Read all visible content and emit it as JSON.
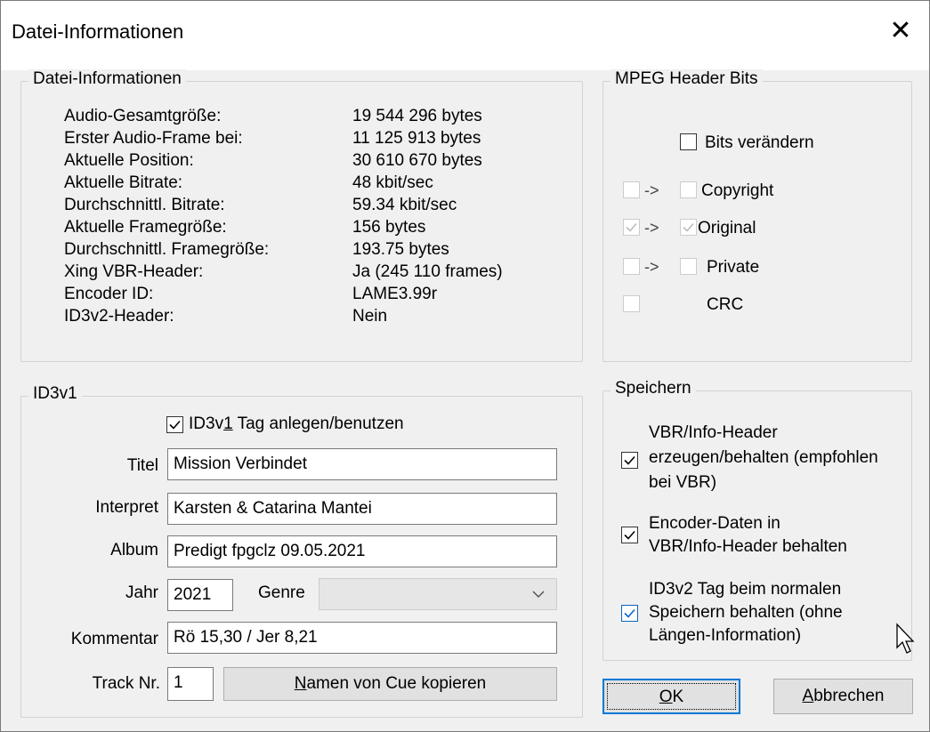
{
  "window": {
    "title": "Datei-Informationen",
    "close_glyph": "✕"
  },
  "file_info": {
    "legend": "Datei-Informationen",
    "rows": [
      {
        "label": "Audio-Gesamtgröße:",
        "value": "19 544 296 bytes"
      },
      {
        "label": "Erster Audio-Frame bei:",
        "value": "11 125 913 bytes"
      },
      {
        "label": "Aktuelle Position:",
        "value": "30 610 670 bytes"
      },
      {
        "label": "Aktuelle Bitrate:",
        "value": "48 kbit/sec"
      },
      {
        "label": "Durchschnittl. Bitrate:",
        "value": "59.34 kbit/sec"
      },
      {
        "label": "Aktuelle Framegröße:",
        "value": "156 bytes"
      },
      {
        "label": "Durchschnittl. Framegröße:",
        "value": "193.75 bytes"
      },
      {
        "label": "Xing VBR-Header:",
        "value": "Ja (245 110 frames)"
      },
      {
        "label": "Encoder ID:",
        "value": "LAME3.99r"
      },
      {
        "label": "ID3v2-Header:",
        "value": "Nein"
      }
    ]
  },
  "mpeg": {
    "legend": "MPEG Header Bits",
    "bits_change_label": "Bits verändern",
    "bits_change_checked": false,
    "arrow": "->",
    "rows": [
      {
        "label": "Copyright",
        "left_checked": false,
        "right_checked": false
      },
      {
        "label": "Original",
        "left_checked": true,
        "right_checked": true
      },
      {
        "label": "Private",
        "left_checked": false,
        "right_checked": false
      }
    ],
    "crc_label": "CRC",
    "crc_checked": false
  },
  "id3v1": {
    "legend": "ID3v1",
    "use_tag_label_pre": "ID3v",
    "use_tag_label_underlined": "1",
    "use_tag_label_post": " Tag anlegen/benutzen",
    "use_tag_checked": true,
    "title_label": "Titel",
    "title_value": "Mission Verbindet",
    "artist_label": "Interpret",
    "artist_value": "Karsten & Catarina Mantei",
    "album_label": "Album",
    "album_value": "Predigt fpgclz 09.05.2021",
    "year_label": "Jahr",
    "year_value": "2021",
    "genre_label": "Genre",
    "genre_value": "",
    "comment_label": "Kommentar",
    "comment_value": "Rö 15,30 / Jer 8,21",
    "track_label": "Track Nr.",
    "track_value": "1",
    "copy_btn_underlined": "N",
    "copy_btn_rest": "amen von Cue kopieren"
  },
  "save": {
    "legend": "Speichern",
    "vbr_line1": "VBR/Info-Header",
    "vbr_line2": "erzeugen/behalten (empfohlen",
    "vbr_line3": "bei VBR)",
    "vbr_checked": true,
    "enc_line1": "Encoder-Daten in",
    "enc_line2": "VBR/Info-Header behalten",
    "enc_checked": true,
    "id3_line1": "ID3v2 Tag beim normalen",
    "id3_line2": "Speichern behalten (ohne",
    "id3_line3": "Längen-Information)",
    "id3_checked": true
  },
  "buttons": {
    "ok_underlined": "O",
    "ok_rest": "K",
    "cancel_underlined": "A",
    "cancel_rest": "bbrechen"
  }
}
